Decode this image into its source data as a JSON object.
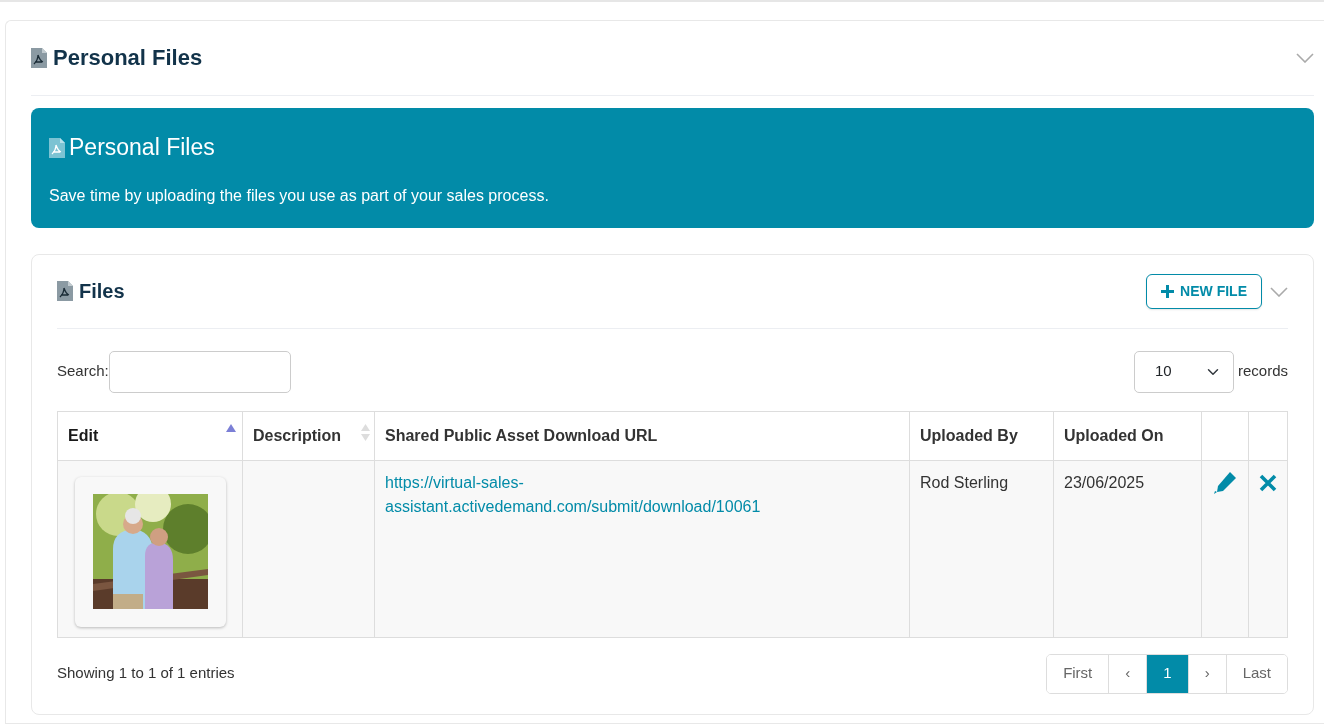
{
  "panel": {
    "title": "Personal Files",
    "expanded": true
  },
  "banner": {
    "title": "Personal Files",
    "text": "Save time by uploading the files you use as part of your sales process."
  },
  "files_card": {
    "title": "Files",
    "new_button": "NEW FILE",
    "expanded": true
  },
  "search": {
    "label": "Search:"
  },
  "page_size": {
    "value": "10",
    "label": "records"
  },
  "table": {
    "columns": [
      {
        "label": "Edit",
        "sortable": true,
        "sorted": true
      },
      {
        "label": "Description",
        "sortable": true,
        "sorted": false
      },
      {
        "label": "Shared Public Asset Download URL",
        "sortable": false,
        "sorted": false
      },
      {
        "label": "Uploaded By",
        "sortable": false,
        "sorted": false
      },
      {
        "label": "Uploaded On",
        "sortable": false,
        "sorted": false
      },
      {
        "sortable": false,
        "sorted": false
      },
      {
        "sortable": false,
        "sorted": false
      }
    ],
    "rows": [
      {
        "description": "",
        "url_lines": [
          "https://virtual-sales-",
          "assistant.activedemand.com/submit/download/10061"
        ],
        "uploaded_by": "Rod Sterling",
        "uploaded_on": "23/06/2025"
      }
    ]
  },
  "footer": {
    "info": "Showing 1 to 1 of 1 entries"
  },
  "pagination": [
    {
      "label": "First",
      "selected": false
    },
    {
      "label": "‹",
      "selected": false
    },
    {
      "label": "1",
      "selected": true
    },
    {
      "label": "›",
      "selected": false
    },
    {
      "label": "Last",
      "selected": false
    }
  ]
}
